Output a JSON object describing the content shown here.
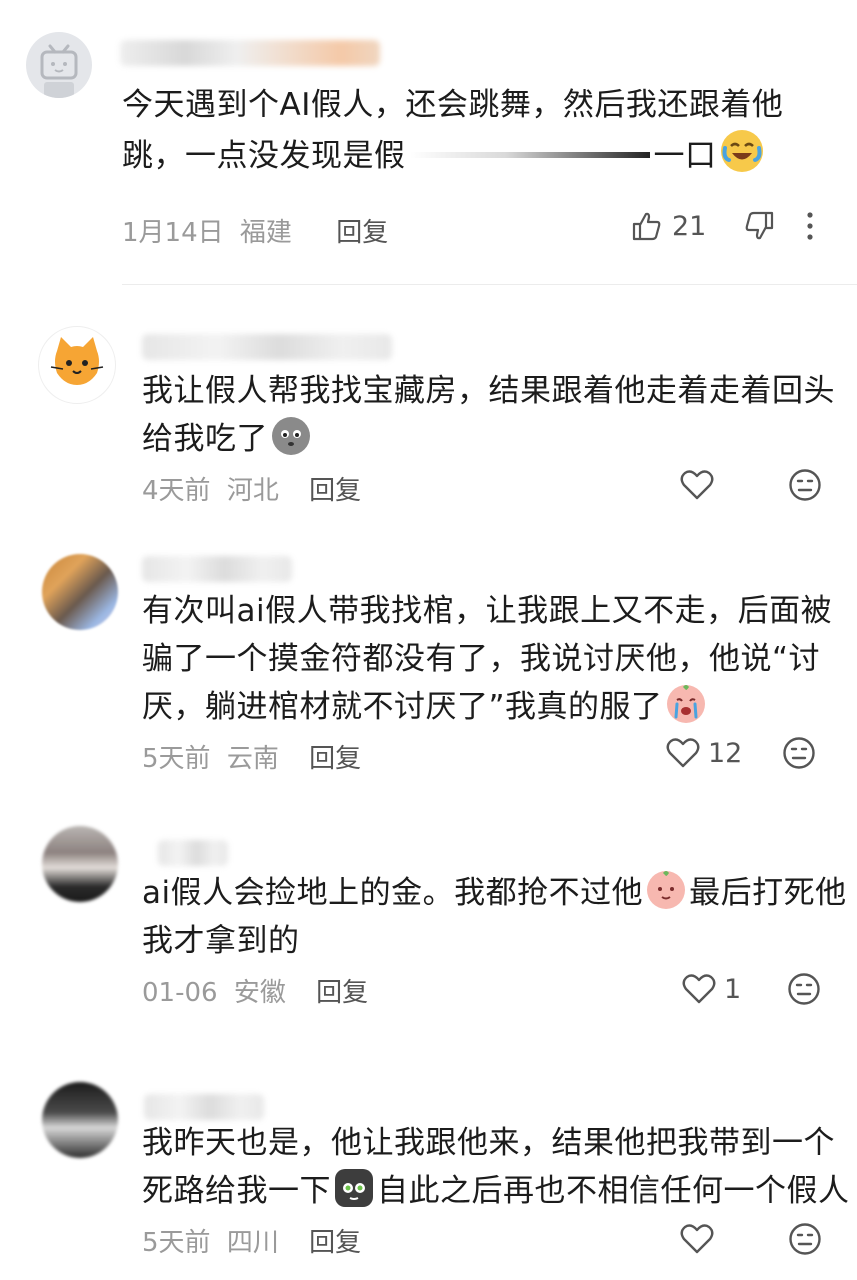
{
  "comments": [
    {
      "line1": "今天遇到个AI假人，还会跳舞，然后我还跟着他",
      "line2_start": "跳，一点没发现是假",
      "line2_end": "一口",
      "date": "1月14日",
      "location": "福建",
      "reply": "回复",
      "likes": "21",
      "emoji": "laughing-crying-emoji"
    },
    {
      "line1": "我让假人帮我找宝藏房，结果跟着他走着走着回头",
      "line2": "给我吃了",
      "date": "4天前",
      "location": "河北",
      "reply": "回复",
      "emoji": "ghost-emoji"
    },
    {
      "line1": "有次叫ai假人带我找棺，让我跟上又不走，后面被",
      "line2": "骗了一个摸金符都没有了，我说讨厌他，他说“讨",
      "line3": "厌，躺进棺材就不讨厌了”我真的服了",
      "date": "5天前",
      "location": "云南",
      "reply": "回复",
      "likes": "12",
      "emoji": "crying-peach-emoji"
    },
    {
      "line1_start": "ai假人会捡地上的金。我都抢不过他",
      "line1_end": "最后打死他",
      "line2": "我才拿到的",
      "date": "01-06",
      "location": "安徽",
      "reply": "回复",
      "likes": "1",
      "emoji": "peach-emoji"
    },
    {
      "line1": "我昨天也是，他让我跟他来，结果他把我带到一个",
      "line2_start": "死路给我一下",
      "line2_end": "自此之后再也不相信任何一个假人",
      "date": "5天前",
      "location": "四川",
      "reply": "回复",
      "emoji": "cat-emoji"
    }
  ],
  "colors": {
    "text": "#1c1c1c",
    "meta": "#9a9a9a",
    "icon": "#555555"
  }
}
